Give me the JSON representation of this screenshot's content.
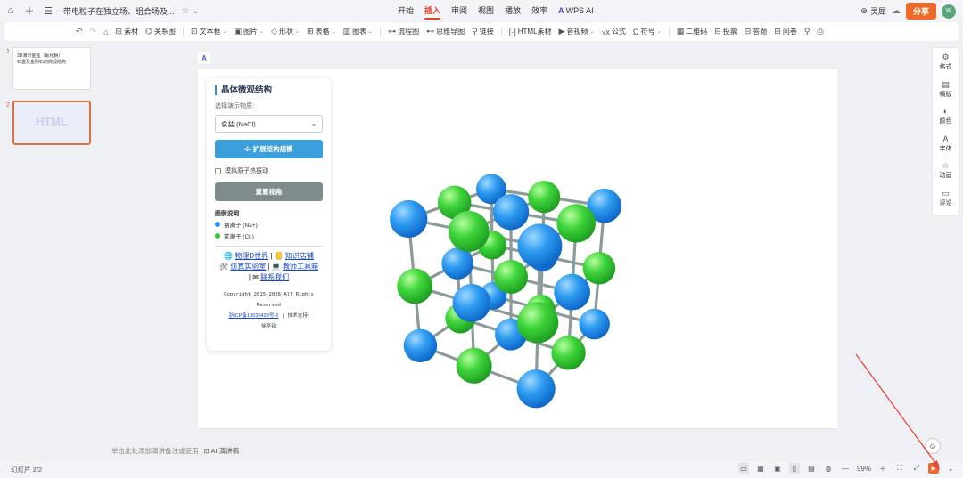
{
  "titlebar": {
    "doc_title": "带电粒子在独立场、组合场及...",
    "menu_tabs": [
      "开始",
      "插入",
      "审阅",
      "视图",
      "播放",
      "效率"
    ],
    "active_tab": "插入",
    "wps_ai_label": "WPS AI",
    "lingxi_label": "灵犀",
    "share_label": "分享",
    "avatar_initial": "W"
  },
  "toolbar": {
    "items": [
      {
        "icon": "⊞",
        "label": "素材",
        "caret": false
      },
      {
        "icon": "⌬",
        "label": "关系图",
        "caret": false
      },
      {
        "icon": "⊡",
        "label": "文本框",
        "caret": true
      },
      {
        "icon": "▣",
        "label": "图片",
        "caret": true
      },
      {
        "icon": "◇",
        "label": "形状",
        "caret": true
      },
      {
        "icon": "⊞",
        "label": "表格",
        "caret": true
      },
      {
        "icon": "▥",
        "label": "图表",
        "caret": true
      },
      {
        "icon": "⊶",
        "label": "流程图",
        "caret": false
      },
      {
        "icon": "⊷",
        "label": "思维导图",
        "caret": false
      },
      {
        "icon": "⚲",
        "label": "链接",
        "caret": false
      },
      {
        "icon": "[·]",
        "label": "HTML素材",
        "caret": false
      },
      {
        "icon": "▶",
        "label": "音视频",
        "caret": true
      },
      {
        "icon": "√x",
        "label": "公式",
        "caret": false
      },
      {
        "icon": "Ω",
        "label": "符号",
        "caret": true
      },
      {
        "icon": "▦",
        "label": "二维码",
        "caret": false
      },
      {
        "icon": "⊟",
        "label": "投票",
        "caret": false
      },
      {
        "icon": "⊟",
        "label": "答题",
        "caret": false
      },
      {
        "icon": "⊟",
        "label": "问卷",
        "caret": false
      }
    ]
  },
  "slides": {
    "thumb1_text": "3D演示金盐（氯化钠）\n石墨及金刚石的微观结构",
    "thumb2_label": "HTML",
    "numbers": [
      "1",
      "2"
    ]
  },
  "panel": {
    "title": "晶体微观结构",
    "select_label": "选择演示物质:",
    "select_value": "食盐 (NaCl)",
    "expand_button": "扩展结构规模",
    "vibration_label": "模拟原子热振动",
    "reset_button": "重置视角",
    "legend_title": "图例说明",
    "legend": [
      {
        "label": "钠离子 (Na+)",
        "color": "#1e90ff"
      },
      {
        "label": "氯离子 (Cl-)",
        "color": "#32c832"
      }
    ],
    "links": [
      "物理D世界",
      "知识店铺",
      "仿真实验室",
      "教师工具箱",
      "联系我们"
    ],
    "copyright_line1": "Copyright 2015-2026 All Rights",
    "copyright_line2": "Reserved",
    "icp": "浙ICP备13035423号-2",
    "support": "技术支持:",
    "author": "徐圣钦"
  },
  "notes": {
    "placeholder": "单击此处添加演讲备注或使用",
    "ai_label": "AI 演讲稿"
  },
  "right_bar": [
    "格式",
    "横版",
    "颜色",
    "字体",
    "动画",
    "评论"
  ],
  "status": {
    "slide_count": "幻灯片 2/2",
    "zoom": "99%"
  },
  "colors": {
    "na": "#1e90ff",
    "cl": "#32c832",
    "bond": "#8c9a9a",
    "accent": "#e0432b",
    "share": "#ee6a2a"
  }
}
